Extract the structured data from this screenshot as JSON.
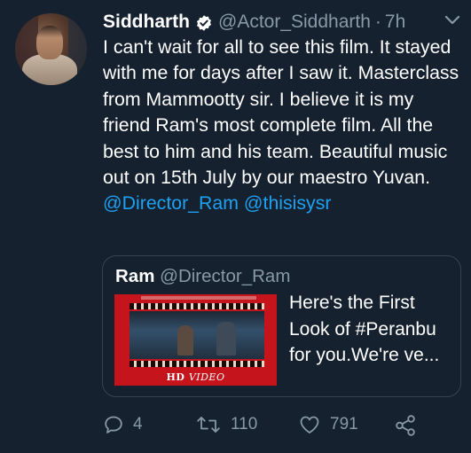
{
  "tweet": {
    "author_name": "Siddharth",
    "author_handle": "@Actor_Siddharth",
    "separator": "·",
    "timestamp": "7h",
    "text_parts": [
      "I can't wait for all to see this film. It stayed with me for days after I saw it. Masterclass from Mammootty sir. I believe it is my friend Ram's most complete film. All the best to him and his team. Beautiful music out on 15th July by our maestro Yuvan. ",
      "@Director_Ram",
      "@thisisysr"
    ]
  },
  "quoted": {
    "author_name": "Ram",
    "author_handle": "@Director_Ram",
    "text": "Here's the First Look of #Peranbu for you.We're ve...",
    "thumbnail_badge": "HD",
    "thumbnail_badge_suffix": "VIDEO"
  },
  "actions": {
    "replies": "4",
    "retweets": "110",
    "likes": "791"
  },
  "icons": {
    "verified": "verified-badge-icon",
    "menu": "chevron-down-icon",
    "reply": "reply-icon",
    "retweet": "retweet-icon",
    "like": "heart-icon",
    "share": "share-icon"
  },
  "colors": {
    "background": "#16212f",
    "text": "#ffffff",
    "muted": "#8899a6",
    "link": "#1da1f2",
    "border": "#38444d"
  }
}
